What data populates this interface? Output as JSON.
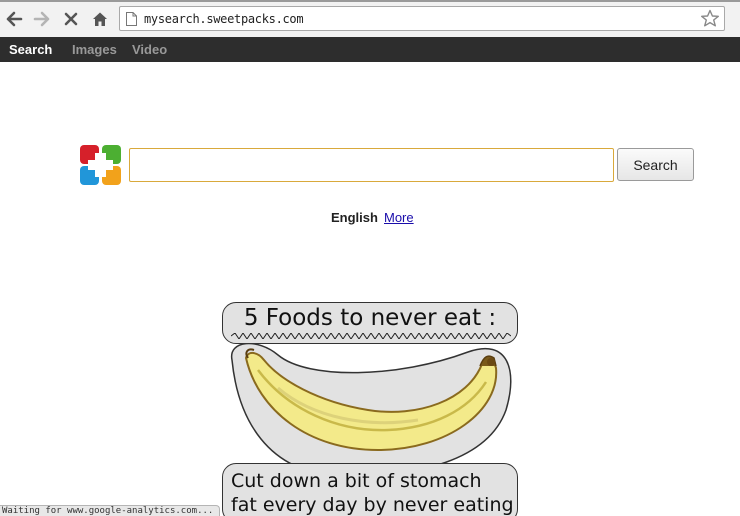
{
  "browser": {
    "url": "mysearch.sweetpacks.com",
    "status_text": "Waiting for www.google-analytics.com..."
  },
  "nav": {
    "items": [
      {
        "label": "Search",
        "active": true
      },
      {
        "label": "Images",
        "active": false
      },
      {
        "label": "Video",
        "active": false
      }
    ]
  },
  "search": {
    "input_value": "",
    "button_label": "Search"
  },
  "language": {
    "current": "English",
    "more_label": "More"
  },
  "ad": {
    "title": "5 Foods to never eat :",
    "line1": "Cut down a bit of stomach",
    "line2": "fat every day by never eating"
  },
  "colors": {
    "navbar": "#2d2d2d",
    "input_border": "#d9a93b",
    "link": "#1a0dab",
    "logo": [
      "#d6202a",
      "#4caf32",
      "#2196d9",
      "#f2a21b"
    ]
  }
}
